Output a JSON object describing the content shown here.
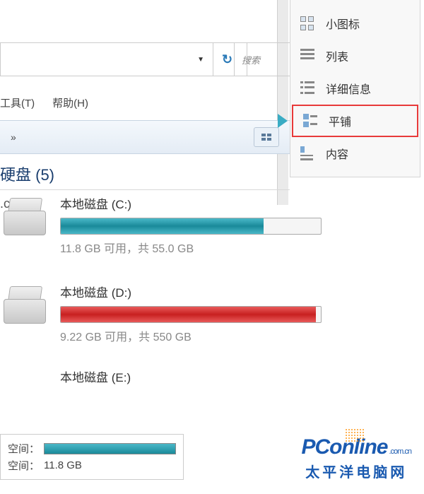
{
  "addressBar": {
    "dropdown": "▼",
    "searchPlaceholder": "搜索"
  },
  "menuBar": {
    "tools": "工具(T)",
    "help": "帮助(H)"
  },
  "toolbar": {
    "chevron": "»"
  },
  "section": {
    "header": "硬盘 (5)",
    "fragment": ".com"
  },
  "drives": [
    {
      "name": "本地磁盘 (C:)",
      "stats": "11.8 GB 可用，共 55.0 GB",
      "fillClass": "fill-teal"
    },
    {
      "name": "本地磁盘 (D:)",
      "stats": "9.22 GB 可用，共 550 GB",
      "fillClass": "fill-red"
    },
    {
      "name": "本地磁盘 (E:)",
      "stats": "",
      "fillClass": ""
    }
  ],
  "viewMenu": {
    "items": [
      {
        "label": "小图标",
        "kind": "small-icons",
        "selected": false
      },
      {
        "label": "列表",
        "kind": "list",
        "selected": false
      },
      {
        "label": "详细信息",
        "kind": "details",
        "selected": false
      },
      {
        "label": "平铺",
        "kind": "tiles",
        "selected": true
      },
      {
        "label": "内容",
        "kind": "content",
        "selected": false
      }
    ]
  },
  "tooltip": {
    "spaceLabel": "空间：",
    "freeLabel": "空间：",
    "freeValue": "11.8 GB"
  },
  "watermark": {
    "brandP": "P",
    "brandC": "C",
    "brandRest": "online",
    "suffix": ".com.cn",
    "cn": "太平洋电脑网"
  }
}
